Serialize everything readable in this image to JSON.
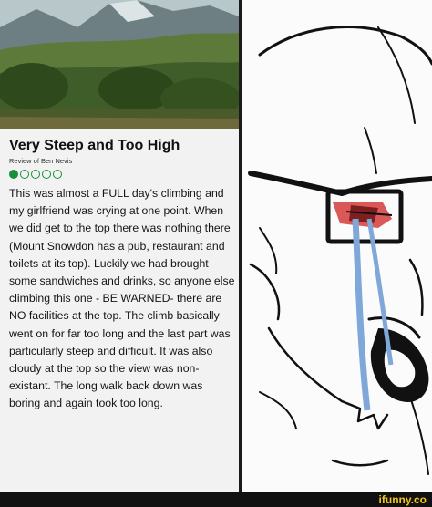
{
  "review": {
    "title": "Very Steep and Too High",
    "review_of": "Review of Ben Nevis",
    "rating": {
      "filled": 1,
      "total": 5
    },
    "body": "This was almost a FULL day's climbing and my girlfriend was crying at one point. When we did get to the top there was nothing there (Mount Snowdon has a pub, restaurant and toilets at its top). Luckily we had brought some sandwiches and drinks, so anyone else climbing this one - BE WARNED- there are NO facilities at the top. The climb basically went on for far too long and the last part was particularly steep and difficult. It was also cloudy at the top so the view was non-existant. The long walk back down was boring and again took too long."
  },
  "meme": {
    "icon": "crying-wojak-icon"
  },
  "footer": {
    "brand": "ifunny.co",
    "brand_color": "#f5c518"
  },
  "colors": {
    "rating_green": "#1a8f3a",
    "tear_blue": "#7fa8d8",
    "eye_red": "#d43b3b"
  }
}
